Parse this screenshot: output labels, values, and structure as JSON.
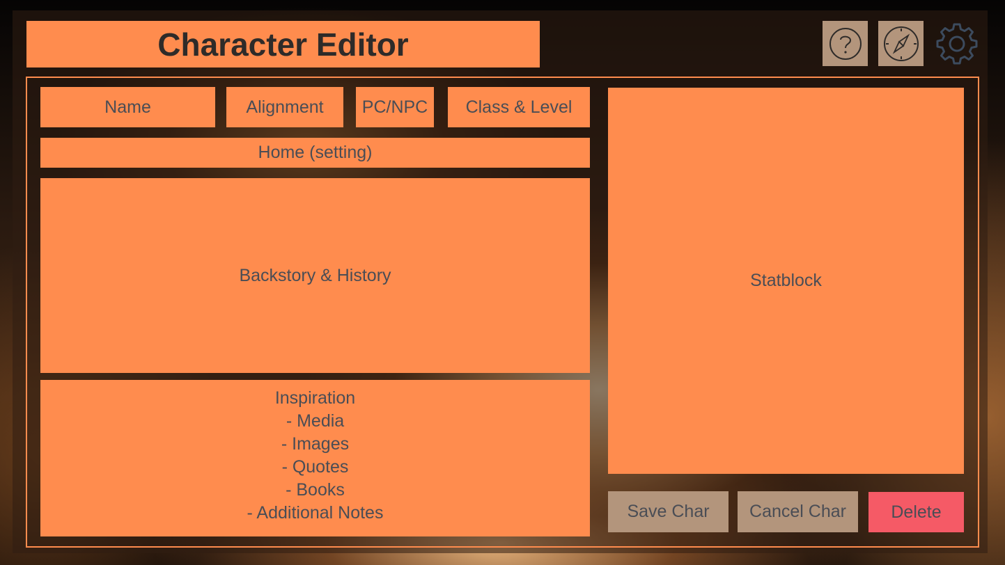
{
  "header": {
    "title": "Character Editor",
    "icons": [
      "help-icon",
      "compass-icon",
      "gear-icon"
    ]
  },
  "fields": {
    "name": "Name",
    "alignment": "Alignment",
    "pc_npc": "PC/NPC",
    "class_level": "Class & Level",
    "home": "Home (setting)",
    "backstory": "Backstory & History",
    "statblock": "Statblock"
  },
  "inspiration": {
    "title": "Inspiration",
    "items": [
      "- Media",
      "- Images",
      "- Quotes",
      "- Books",
      "- Additional Notes"
    ]
  },
  "actions": {
    "save": "Save Char",
    "cancel": "Cancel Char",
    "delete": "Delete"
  },
  "colors": {
    "accent": "#ff8c4e",
    "button_tan": "#b3957c",
    "button_delete": "#f55a66",
    "text": "#4a4d55",
    "title_text": "#2e2b29"
  }
}
